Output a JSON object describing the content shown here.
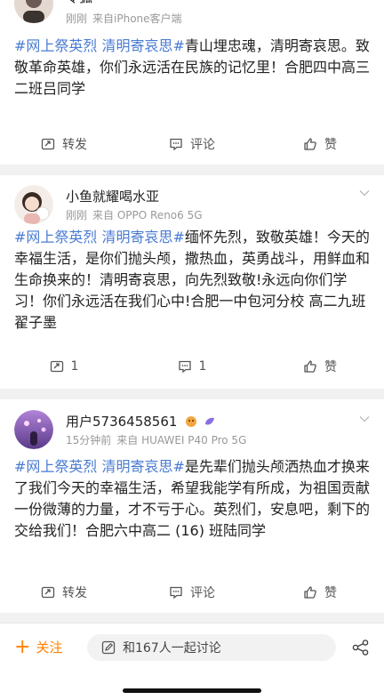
{
  "posts": [
    {
      "username": "令狐",
      "time": "刚刚",
      "source": "来自iPhone客户端",
      "content_tag": "#网上祭英烈 清明寄哀思#",
      "content_text": "青山埋忠魂，清明寄哀思。致敬革命英雄，你们永远活在民族的记忆里！合肥四中高三二班吕同学",
      "repost_label": "转发",
      "comment_label": "评论",
      "like_label": "赞"
    },
    {
      "username": "小鱼就耀喝水亚",
      "time": "刚刚",
      "source": "来自 OPPO Reno6 5G",
      "content_tag": "#网上祭英烈 清明寄哀思#",
      "content_text": "缅怀先烈，致敬英雄！今天的幸福生活，是你们抛头颅，撒热血，英勇战斗，用鲜血和生命换来的！清明寄哀思，向先烈致敬!永远向你们学习！你们永远活在我们心中!合肥一中包河分校 高二九班 翟子墨",
      "repost_label": "1",
      "comment_label": "1",
      "like_label": "赞"
    },
    {
      "username": "用户5736458561",
      "time": "15分钟前",
      "source": "来自 HUAWEI P40 Pro 5G",
      "content_tag": "#网上祭英烈 清明寄哀思#",
      "content_text": "是先辈们抛头颅洒热血才换来了我们今天的幸福生活，希望我能学有所成，为祖国贡献一份微薄的力量，才不亏于心。英烈们，安息吧，剩下的交给我们！合肥六中高二 (16) 班陆同学",
      "repost_label": "转发",
      "comment_label": "评论",
      "like_label": "赞"
    }
  ],
  "bottom_bar": {
    "follow_label": "关注",
    "discuss_label": "和167人一起讨论"
  },
  "colors": {
    "accent_orange": "#ff8200",
    "topic_blue": "#4a7bd2"
  }
}
